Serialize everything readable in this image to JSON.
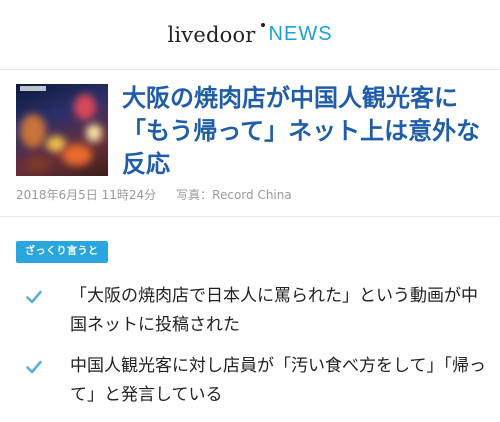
{
  "header": {
    "brand": "livedoor",
    "section": "NEWS"
  },
  "article": {
    "headline": "大阪の焼肉店が中国人観光客に「もう帰って」ネット上は意外な反応",
    "date": "2018年6月5日 11時24分",
    "photo_credit": "写真：Record China"
  },
  "summary": {
    "tag": "ざっくり言うと",
    "items": [
      "「大阪の焼肉店で日本人に罵られた」という動画が中国ネットに投稿された",
      "中国人観光客に対し店員が「汚い食べ方をして」「帰って」と発言している"
    ]
  },
  "colors": {
    "headline": "#1f5da8",
    "accent": "#2aa6de",
    "news_logo": "#1e9fd8",
    "meta": "#9a9a9a"
  },
  "icons": {
    "bullet": "check-icon"
  }
}
